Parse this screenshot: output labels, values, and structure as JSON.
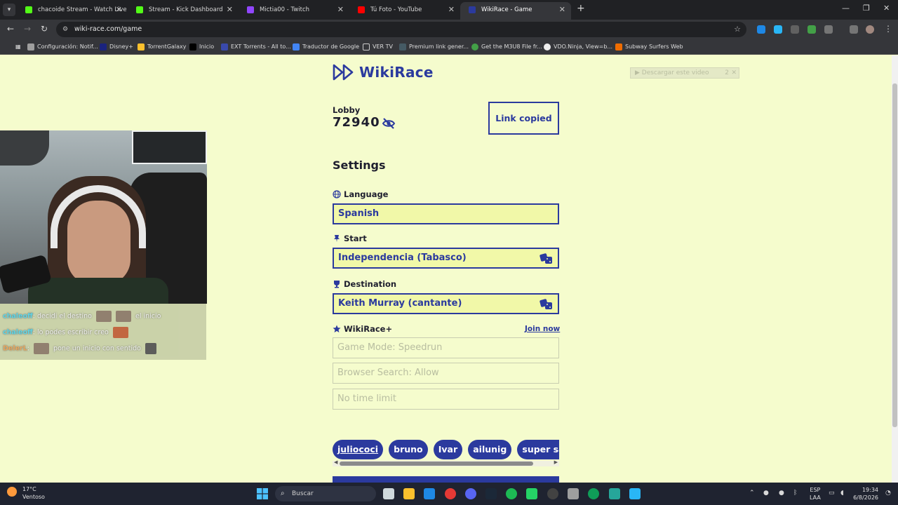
{
  "browser": {
    "tabs": [
      {
        "title": "chacoide Stream - Watch Live o",
        "color": "#53fc18"
      },
      {
        "title": "Stream - Kick Dashboard",
        "color": "#53fc18"
      },
      {
        "title": "Mictia00 - Twitch",
        "color": "#9146ff"
      },
      {
        "title": "Tú Foto - YouTube",
        "color": "#ff0000"
      },
      {
        "title": "WikiRace - Game",
        "color": "#2b3a9e"
      }
    ],
    "url": "wiki-race.com/game",
    "bookmarks": [
      "Configuración: Notif...",
      "Disney+",
      "TorrentGalaxy",
      "Inicio",
      "EXT Torrents - All to...",
      "Traductor de Google",
      "VER TV",
      "Premium link gener...",
      "Get the M3U8 File fr...",
      "VDO.Ninja, View=b...",
      "Subway Surfers Web"
    ]
  },
  "overlay": {
    "chat": [
      {
        "user": "chaleoff",
        "text": "decidi el destino",
        "text2": "el inicio"
      },
      {
        "user": "chaleoff",
        "text": "lo podes escribir creo",
        "text2": ""
      },
      {
        "user": "DelerL",
        "text": "pone un inicio con sentido",
        "text2": ""
      }
    ]
  },
  "app": {
    "logo": "WikiRace",
    "download_button": "▶ Descargar este video",
    "download_badge": "2",
    "lobby_label": "Lobby",
    "lobby_code": "72940",
    "link_button": "Link copied",
    "settings_title": "Settings",
    "language_label": "Language",
    "language_value": "Spanish",
    "start_label": "Start",
    "start_value": "Independencia (Tabasco)",
    "destination_label": "Destination",
    "destination_value": "Keith Murray (cantante)",
    "plus_label": "WikiRace+",
    "join_now": "Join now",
    "game_mode": "Game Mode: Speedrun",
    "browser_search": "Browser Search: Allow",
    "time_limit": "No time limit",
    "players": [
      "juliococi",
      "bruno",
      "Ivar",
      "ailunig",
      "super sas"
    ]
  },
  "taskbar": {
    "temp": "17°C",
    "weather": "Ventoso",
    "search": "Buscar",
    "lang1": "ESP",
    "lang2": "LAA",
    "time": "19:34",
    "date": "6/8/2026"
  },
  "colors": {
    "page_bg": "#f5fccd",
    "accent": "#2b3a9e",
    "field_bg": "#f1f8a8"
  }
}
